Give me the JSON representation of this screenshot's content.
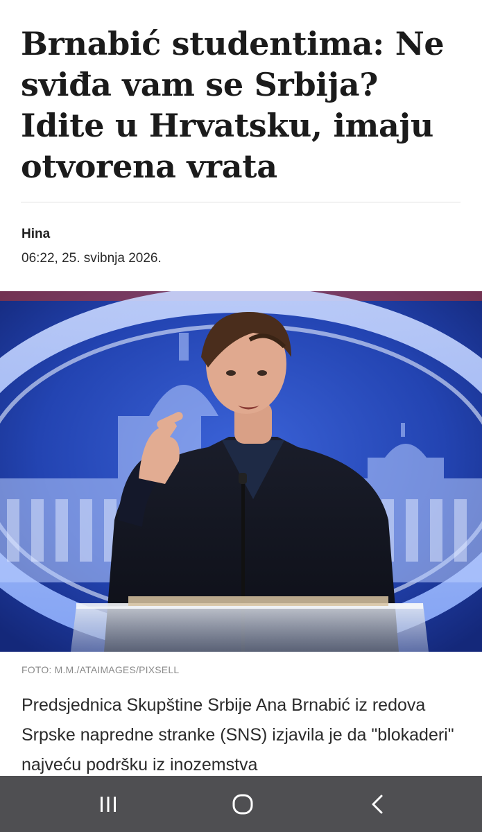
{
  "article": {
    "headline": "Brnabić studentima: Ne sviđa vam se Srbija? Idite u Hrvatsku, imaju otvorena vrata",
    "author": "Hina",
    "datetime": "06:22, 25. svibnja 2026.",
    "photo_caption": "FOTO: M.M./ATAIMAGES/PIXSELL",
    "body": "Predsjednica Skupštine Srbije Ana Brnabić iz redova Srpske napredne stranke (SNS) izjavila je da \"blokaderi\" najveću podršku iz inozemstva"
  },
  "navigation_bar": {
    "icons": [
      "recents-icon",
      "home-icon",
      "back-icon"
    ]
  },
  "colors": {
    "navbar": "#4f4f52",
    "photo_background": "#1f3fa8"
  }
}
